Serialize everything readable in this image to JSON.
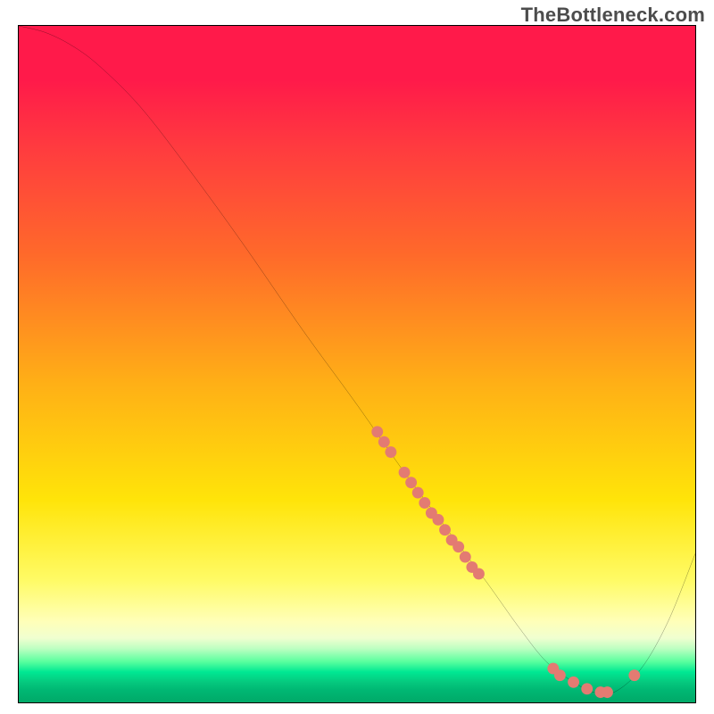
{
  "watermark": "TheBottleneck.com",
  "chart_data": {
    "type": "line",
    "title": "",
    "xlabel": "",
    "ylabel": "",
    "xlim": [
      0,
      100
    ],
    "ylim": [
      0,
      100
    ],
    "curve": {
      "x": [
        0,
        4,
        8,
        12,
        18,
        25,
        33,
        42,
        50,
        57,
        63,
        69,
        74,
        78,
        82,
        85,
        88,
        92,
        96,
        100
      ],
      "y": [
        100,
        99,
        97,
        94,
        88,
        79,
        68,
        55,
        44,
        34,
        26,
        18,
        11,
        6,
        3,
        1.5,
        1.5,
        5,
        12,
        22
      ]
    },
    "markers": [
      {
        "x": 53,
        "y": 40
      },
      {
        "x": 54,
        "y": 38.5
      },
      {
        "x": 55,
        "y": 37
      },
      {
        "x": 57,
        "y": 34
      },
      {
        "x": 58,
        "y": 32.5
      },
      {
        "x": 59,
        "y": 31
      },
      {
        "x": 60,
        "y": 29.5
      },
      {
        "x": 61,
        "y": 28
      },
      {
        "x": 62,
        "y": 27
      },
      {
        "x": 63,
        "y": 25.5
      },
      {
        "x": 64,
        "y": 24
      },
      {
        "x": 65,
        "y": 23
      },
      {
        "x": 66,
        "y": 21.5
      },
      {
        "x": 67,
        "y": 20
      },
      {
        "x": 68,
        "y": 19
      },
      {
        "x": 79,
        "y": 5
      },
      {
        "x": 80,
        "y": 4
      },
      {
        "x": 82,
        "y": 3
      },
      {
        "x": 84,
        "y": 2
      },
      {
        "x": 86,
        "y": 1.5
      },
      {
        "x": 87,
        "y": 1.5
      },
      {
        "x": 91,
        "y": 4
      }
    ],
    "gradient_stops": [
      {
        "pos": 0.0,
        "color": "#ff1a4a"
      },
      {
        "pos": 0.08,
        "color": "#ff1a4a"
      },
      {
        "pos": 0.18,
        "color": "#ff3b3f"
      },
      {
        "pos": 0.34,
        "color": "#ff6a2a"
      },
      {
        "pos": 0.53,
        "color": "#ffb016"
      },
      {
        "pos": 0.7,
        "color": "#ffe409"
      },
      {
        "pos": 0.82,
        "color": "#fffb66"
      },
      {
        "pos": 0.88,
        "color": "#ffffb8"
      },
      {
        "pos": 0.905,
        "color": "#f0ffd0"
      },
      {
        "pos": 0.92,
        "color": "#bfffc2"
      },
      {
        "pos": 0.94,
        "color": "#58ff9e"
      },
      {
        "pos": 0.955,
        "color": "#00e893"
      },
      {
        "pos": 0.97,
        "color": "#05c97e"
      },
      {
        "pos": 0.982,
        "color": "#00b773"
      },
      {
        "pos": 1.0,
        "color": "#00a968"
      }
    ],
    "marker_color": "#e37b72",
    "curve_color": "#000000"
  }
}
